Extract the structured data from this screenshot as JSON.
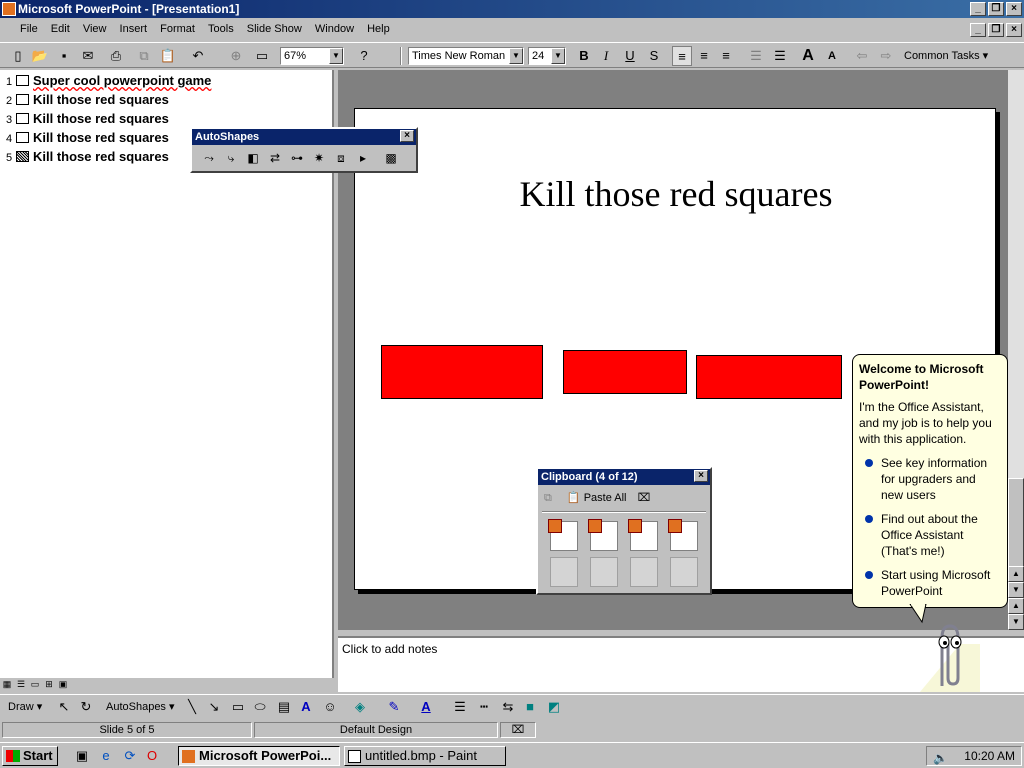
{
  "window": {
    "title": "Microsoft PowerPoint - [Presentation1]"
  },
  "menu": [
    "File",
    "Edit",
    "View",
    "Insert",
    "Format",
    "Tools",
    "Slide Show",
    "Window",
    "Help"
  ],
  "toolbar": {
    "zoom": "67%",
    "font": "Times New Roman",
    "font_size": "24",
    "common_tasks": "Common Tasks"
  },
  "outline": [
    {
      "num": "1",
      "title": "Super cool powerpoint game"
    },
    {
      "num": "2",
      "title": "Kill those red squares"
    },
    {
      "num": "3",
      "title": "Kill those red squares"
    },
    {
      "num": "4",
      "title": "Kill those red squares"
    },
    {
      "num": "5",
      "title": "Kill those red squares"
    }
  ],
  "autoshapes": {
    "title": "AutoShapes"
  },
  "slide": {
    "title": "Kill those red squares",
    "square_color": "#ff0000"
  },
  "clipboard": {
    "title": "Clipboard (4 of 12)",
    "paste_all": "Paste All"
  },
  "assistant": {
    "heading": "Welcome to Microsoft PowerPoint!",
    "intro": "I'm the Office Assistant, and my job is to help you with this application.",
    "options": [
      "See key information for upgraders and new users",
      "Find out about the Office Assistant (That's me!)",
      "Start using Microsoft PowerPoint"
    ]
  },
  "notes": {
    "placeholder": "Click to add notes"
  },
  "drawbar": {
    "draw": "Draw",
    "autoshapes": "AutoShapes"
  },
  "status": {
    "slide": "Slide 5 of 5",
    "design": "Default Design"
  },
  "taskbar": {
    "start": "Start",
    "tasks": [
      "Microsoft PowerPoi...",
      "untitled.bmp - Paint"
    ],
    "clock": "10:20 AM"
  },
  "colors": {
    "title_bar": "#0a246a",
    "balloon": "#ffffe1"
  }
}
